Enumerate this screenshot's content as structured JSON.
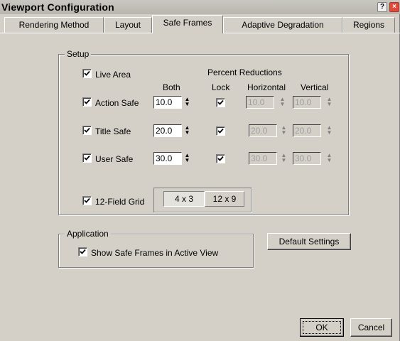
{
  "window": {
    "title": "Viewport Configuration",
    "help_glyph": "?",
    "close_glyph": "×"
  },
  "tabs": [
    {
      "label": "Rendering Method",
      "active": false
    },
    {
      "label": "Layout",
      "active": false
    },
    {
      "label": "Safe Frames",
      "active": true
    },
    {
      "label": "Adaptive Degradation",
      "active": false
    },
    {
      "label": "Regions",
      "active": false
    }
  ],
  "setup": {
    "label": "Setup",
    "percent_reductions_label": "Percent Reductions",
    "col_both": "Both",
    "col_lock": "Lock",
    "col_horizontal": "Horizontal",
    "col_vertical": "Vertical",
    "live_area": {
      "label": "Live Area",
      "checked": true
    },
    "rows": [
      {
        "label": "Action Safe",
        "checked": true,
        "both": "10.0",
        "lock": true,
        "horizontal": "10.0",
        "vertical": "10.0"
      },
      {
        "label": "Title Safe",
        "checked": true,
        "both": "20.0",
        "lock": true,
        "horizontal": "20.0",
        "vertical": "20.0"
      },
      {
        "label": "User Safe",
        "checked": true,
        "both": "30.0",
        "lock": true,
        "horizontal": "30.0",
        "vertical": "30.0"
      }
    ],
    "field_grid": {
      "label": "12-Field Grid",
      "checked": true,
      "option_a": "4 x 3",
      "option_b": "12 x 9",
      "selected": "4 x 3"
    }
  },
  "application": {
    "label": "Application",
    "show_safe_frames": {
      "label": "Show Safe Frames in Active View",
      "checked": true
    }
  },
  "buttons": {
    "default_settings": "Default Settings",
    "ok": "OK",
    "cancel": "Cancel"
  },
  "spinner_glyphs": {
    "up": "▲",
    "down": "▼"
  }
}
